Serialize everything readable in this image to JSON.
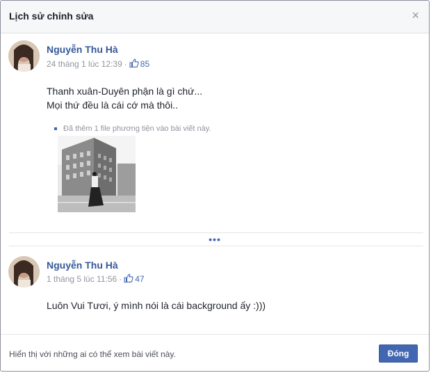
{
  "dialog": {
    "title": "Lịch sử chỉnh sửa",
    "close_icon": "×"
  },
  "posts": [
    {
      "author": "Nguyễn Thu Hà",
      "timestamp": "24 tháng 1 lúc 12:39",
      "separator": "·",
      "like_icon": "thumbs-up-icon",
      "likes": "85",
      "text_lines": [
        "Thanh xuân-Duyên phận là gì chứ...",
        "Mọi thứ đều là cái cớ mà thôi.."
      ],
      "media_note": "Đã thêm 1 file phương tiện vào bài viết này."
    },
    {
      "author": "Nguyễn Thu Hà",
      "timestamp": "1 tháng 5 lúc 11:56",
      "separator": "·",
      "like_icon": "thumbs-up-icon",
      "likes": "47",
      "text_lines": [
        "Luôn Vui Tươi, ý mình nói là cái background ấy :)))"
      ]
    }
  ],
  "more_dots": "•••",
  "footer": {
    "visibility_text": "Hiển thị với những ai có thể xem bài viết này.",
    "close_button": "Đóng"
  },
  "colors": {
    "accent": "#4267b2",
    "author_link": "#365899",
    "muted": "#90949c"
  }
}
